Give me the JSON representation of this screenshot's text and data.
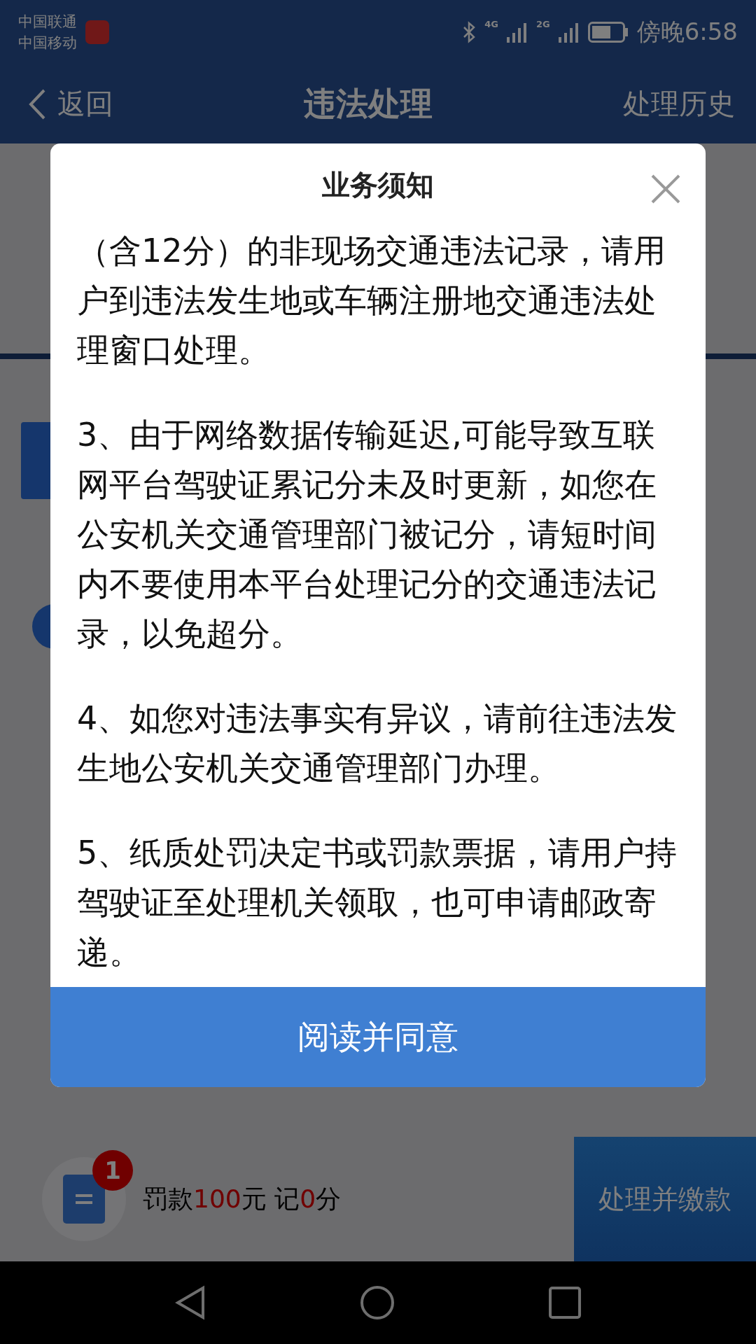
{
  "status_bar": {
    "carriers": [
      "中国联通",
      "中国移动"
    ],
    "time": "傍晚6:58",
    "network_1": "4G",
    "network_2": "2G"
  },
  "nav": {
    "back": "返回",
    "title": "违法处理",
    "action": "处理历史"
  },
  "bottom_bar": {
    "badge": "1",
    "fine": [
      {
        "text": "罚款",
        "highlight": false
      },
      {
        "text": "100",
        "highlight": true
      },
      {
        "text": "元 记",
        "highlight": false
      },
      {
        "text": "0",
        "highlight": true
      },
      {
        "text": "分",
        "highlight": false
      }
    ],
    "button": "处理并缴款"
  },
  "dialog": {
    "title": "业务须知",
    "paragraphs": [
      "（含12分）的非现场交通违法记录，请用户到违法发生地或车辆注册地交通违法处理窗口处理。",
      "3、由于网络数据传输延迟,可能导致互联网平台驾驶证累记分未及时更新，如您在公安机关交通管理部门被记分，请短时间内不要使用本平台处理记分的交通违法记录，以免超分。",
      "4、如您对违法事实有异议，请前往违法发生地公安机关交通管理部门办理。",
      "5、纸质处罚决定书或罚款票据，请用户持驾驶证至处理机关领取，也可申请邮政寄递。"
    ],
    "confirm": "阅读并同意"
  }
}
